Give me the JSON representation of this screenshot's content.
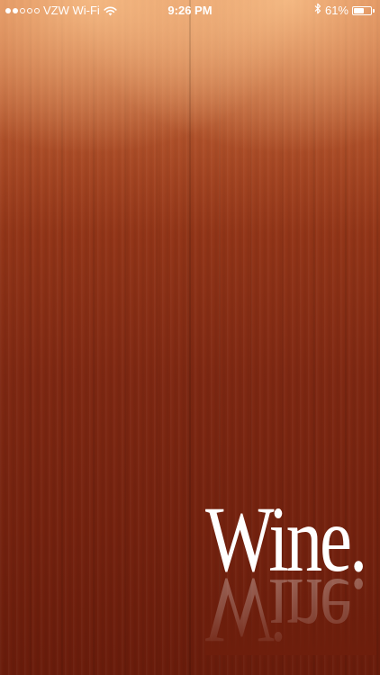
{
  "status_bar": {
    "carrier": "VZW Wi-Fi",
    "time": "9:26 PM",
    "battery_percent": "61%",
    "battery_level": 0.61,
    "signal_bars_filled": 2,
    "signal_bars_total": 5,
    "icons": {
      "wifi": "wifi-icon",
      "bluetooth": "bluetooth-icon",
      "battery": "battery-icon"
    }
  },
  "splash": {
    "logo_text": "Wine."
  },
  "colors": {
    "wood_base": "#7f2812",
    "wood_highlight": "#e89a6a",
    "text": "#ffffff"
  }
}
